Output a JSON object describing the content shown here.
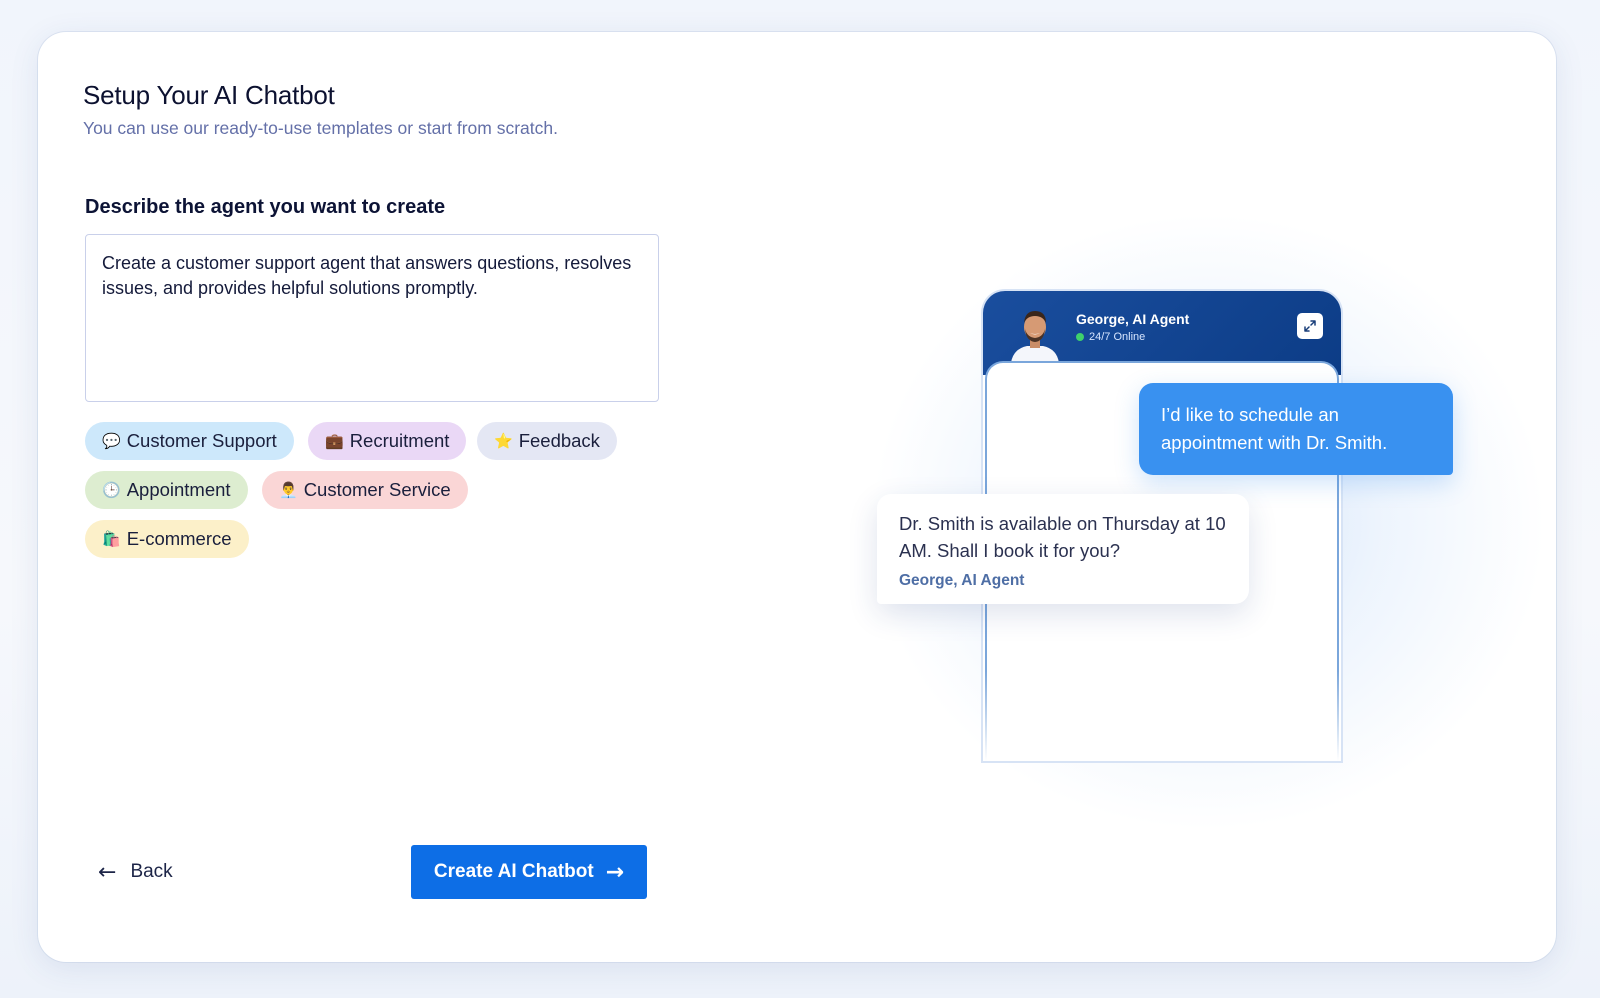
{
  "header": {
    "title": "Setup Your AI Chatbot",
    "subtitle": "You can use our ready-to-use templates or start from scratch."
  },
  "form": {
    "label": "Describe the agent you want to create",
    "prompt_value": "Create a customer support agent that answers questions, resolves issues, and provides helpful solutions promptly."
  },
  "templates": [
    {
      "emoji": "💬",
      "label": "Customer Support",
      "bg": "#cde8fb"
    },
    {
      "emoji": "💼",
      "label": "Recruitment",
      "bg": "#ead8f6"
    },
    {
      "emoji": "⭐",
      "label": "Feedback",
      "bg": "#e4e7f4"
    },
    {
      "emoji": "🕒",
      "label": "Appointment",
      "bg": "#ddedd0"
    },
    {
      "emoji": "👨‍💼",
      "label": "Customer Service",
      "bg": "#fad6d6"
    },
    {
      "emoji": "🛍️",
      "label": "E-commerce",
      "bg": "#fcf0c9"
    }
  ],
  "actions": {
    "back_label": "Back",
    "create_label": "Create AI Chatbot"
  },
  "preview": {
    "agent_name": "George, AI Agent",
    "agent_status": "24/7 Online",
    "user_message": "I’d like to schedule an appointment with Dr. Smith.",
    "agent_message": "Dr. Smith is available on Thursday at 10 AM. Shall I book it for you?",
    "agent_signature": "George, AI Agent"
  },
  "colors": {
    "primary": "#0d6ee6",
    "user_bubble": "#3991f0",
    "header_blue": "#1a4e9e",
    "online": "#3fd16b"
  }
}
